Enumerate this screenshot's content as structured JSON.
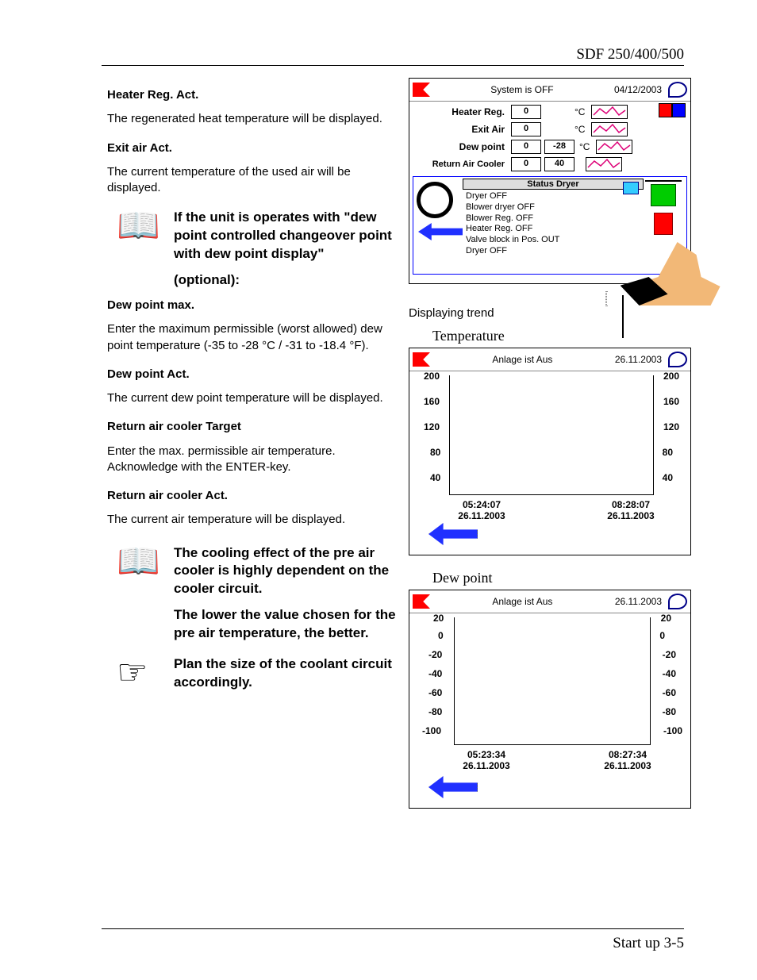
{
  "header": {
    "model": "SDF 250/400/500"
  },
  "footer": {
    "label": "Start up 3-5"
  },
  "left": {
    "h1": "Heater Reg. Act.",
    "p1": "The regenerated heat temperature will be displayed.",
    "h2": "Exit air Act.",
    "p2": "The current temperature of the used air will be displayed.",
    "note1a": "If the unit is operates with \"dew point controlled changeover point with dew point display\"",
    "note1b": "(optional):",
    "h3": "Dew point max.",
    "p3": "Enter the maximum permissible (worst allowed) dew point temperature (-35 to -28 °C / -31 to -18.4 °F).",
    "h4": "Dew point Act.",
    "p4": "The current dew point temperature will be displayed.",
    "h5": "Return air cooler Target",
    "p5": "Enter the max. permissible air temperature. Acknowledge with the ENTER-key.",
    "h6": "Return air cooler Act.",
    "p6": "The current air temperature will be displayed.",
    "note2a": "The cooling effect of the pre air cooler is highly dependent on the cooler circuit.",
    "note2b": "The lower the value chosen for the pre air temperature, the better.",
    "note3": "Plan the size of the coolant circuit accordingly."
  },
  "hmi": {
    "status": "System is OFF",
    "date": "04/12/2003",
    "rows": [
      {
        "label": "Heater Reg.",
        "v1": "0",
        "v2": "",
        "unit": "°C"
      },
      {
        "label": "Exit Air",
        "v1": "0",
        "v2": "",
        "unit": "°C"
      },
      {
        "label": "Dew point",
        "v1": "0",
        "v2": "-28",
        "unit": "°C"
      },
      {
        "label": "Return Air Cooler",
        "v1": "0",
        "v2": "40",
        "unit": ""
      }
    ],
    "statusTitle": "Status Dryer",
    "statusLines": [
      "Dryer OFF",
      "Blower dryer OFF",
      "Blower Reg. OFF",
      "Heater Reg. OFF",
      "Valve block in Pos. OUT",
      "Dryer OFF"
    ],
    "trendLabel": "Displaying trend"
  },
  "chart1": {
    "title": "Temperature",
    "top": {
      "status": "Anlage ist Aus",
      "date": "26.11.2003"
    }
  },
  "chart2": {
    "title": "Dew point",
    "top": {
      "status": "Anlage ist Aus",
      "date": "26.11.2003"
    }
  },
  "chart_data": [
    {
      "type": "line",
      "title": "Temperature",
      "ylabel": "",
      "ylim": [
        40,
        200
      ],
      "yticks": [
        40,
        80,
        120,
        160,
        200
      ],
      "categories": [
        "05:24:07 26.11.2003",
        "08:28:07 26.11.2003"
      ],
      "series": [
        {
          "name": "Temperature",
          "values": []
        }
      ]
    },
    {
      "type": "line",
      "title": "Dew point",
      "ylabel": "",
      "ylim": [
        -100,
        20
      ],
      "yticks": [
        -100,
        -80,
        -60,
        -40,
        -20,
        0,
        20
      ],
      "categories": [
        "05:23:34 26.11.2003",
        "08:27:34 26.11.2003"
      ],
      "series": [
        {
          "name": "Dew point",
          "values": []
        }
      ]
    }
  ]
}
